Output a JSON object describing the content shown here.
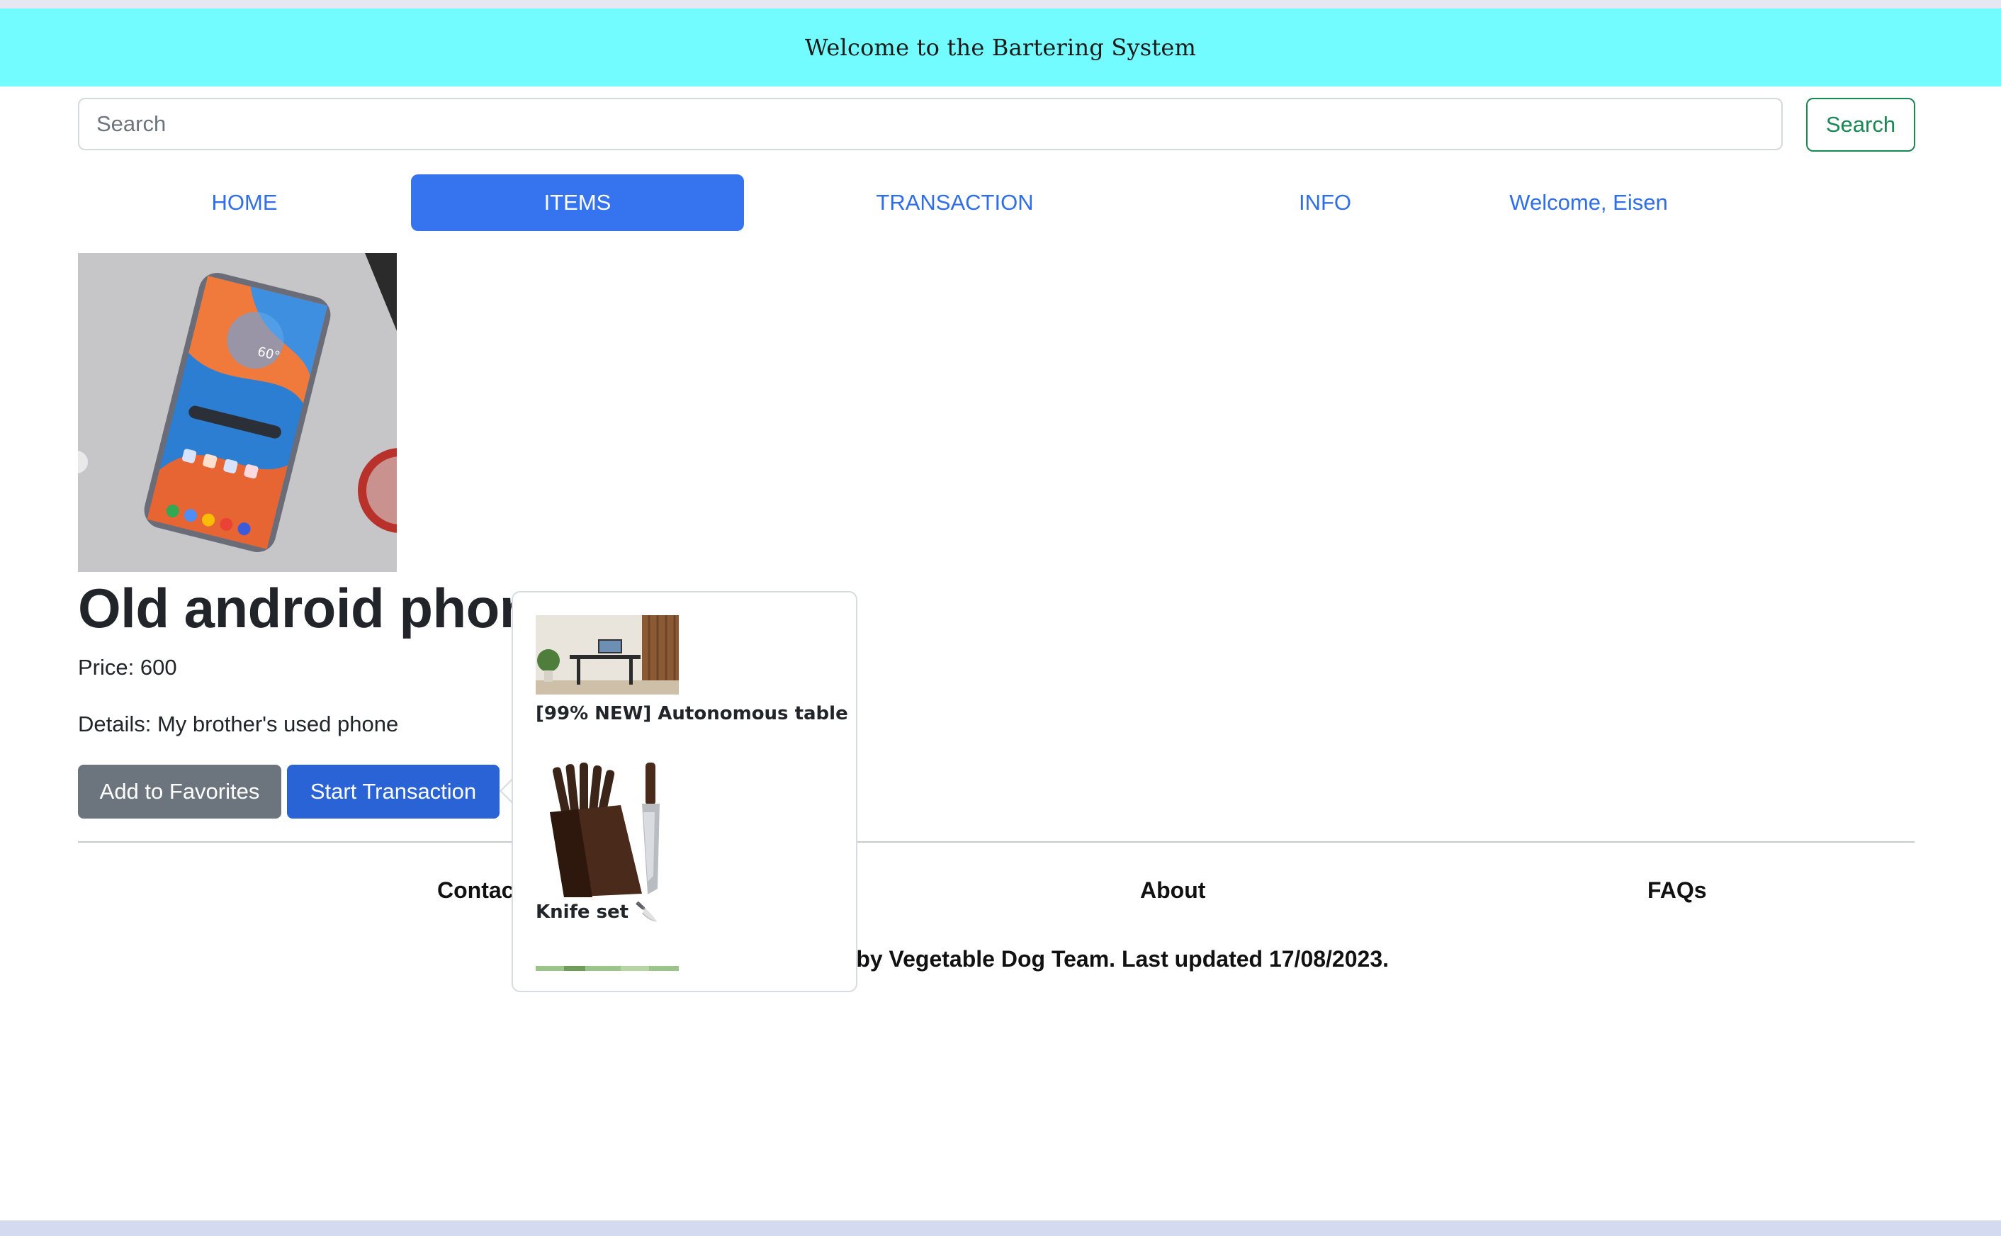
{
  "banner": {
    "title": "Welcome to the Bartering System"
  },
  "search": {
    "placeholder": "Search",
    "button_label": "Search"
  },
  "nav": {
    "items": [
      {
        "label": "HOME",
        "active": false
      },
      {
        "label": "ITEMS",
        "active": true
      },
      {
        "label": "TRANSACTION",
        "active": false
      },
      {
        "label": "INFO",
        "active": false
      },
      {
        "label": "Welcome, Eisen",
        "active": false
      }
    ]
  },
  "product": {
    "title": "Old android phone",
    "price": "Price: 600",
    "details": "Details: My brother's used phone",
    "phone_screen_text": "60°",
    "favorites_label": "Add to Favorites",
    "transaction_label": "Start Transaction"
  },
  "popup": {
    "items": [
      {
        "caption": "[99% NEW] Autonomous table",
        "thumb": "desk-photo"
      },
      {
        "caption": "Knife set 🔪",
        "thumb": "knife-set-photo"
      },
      {
        "caption": "",
        "thumb": "plant-photo"
      }
    ]
  },
  "footer": {
    "links": [
      "Contact",
      "About",
      "FAQs"
    ],
    "text": "Made by Vegetable Dog Team. Last updated 17/08/2023."
  },
  "colors": {
    "banner_bg": "#73fcff",
    "primary": "#3673ef",
    "secondary": "#6c757d",
    "success": "#198754"
  }
}
